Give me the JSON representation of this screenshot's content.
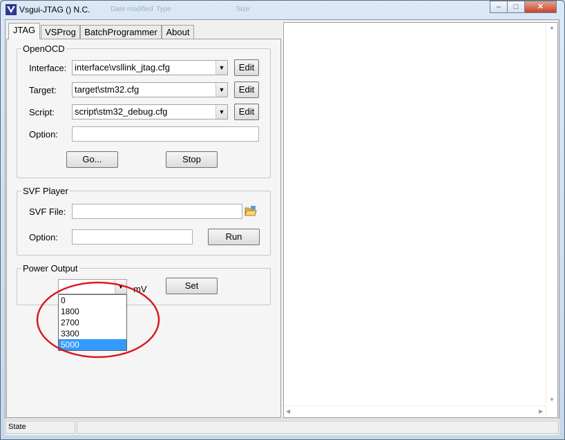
{
  "window": {
    "title": "Vsgui-JTAG () N.C.",
    "ghost_titles": [
      "Date modified",
      "Type",
      "Size"
    ],
    "caption_buttons": {
      "minimize": "–",
      "maximize": "□",
      "close": "✕"
    }
  },
  "tabs": [
    {
      "label": "JTAG",
      "active": true
    },
    {
      "label": "VSProg",
      "active": false
    },
    {
      "label": "BatchProgrammer",
      "active": false
    },
    {
      "label": "About",
      "active": false
    }
  ],
  "openocd": {
    "title": "OpenOCD",
    "interface_label": "Interface:",
    "interface_value": "interface\\vsllink_jtag.cfg",
    "target_label": "Target:",
    "target_value": "target\\stm32.cfg",
    "script_label": "Script:",
    "script_value": "script\\stm32_debug.cfg",
    "option_label": "Option:",
    "option_value": "",
    "edit_label": "Edit",
    "go_label": "Go...",
    "stop_label": "Stop"
  },
  "svf": {
    "title": "SVF Player",
    "file_label": "SVF File:",
    "file_value": "",
    "option_label": "Option:",
    "option_value": "",
    "run_label": "Run"
  },
  "power": {
    "title": "Power Output",
    "value": "",
    "unit": "mV",
    "set_label": "Set",
    "options": [
      "0",
      "1800",
      "2700",
      "3300",
      "5000"
    ],
    "selected": "5000"
  },
  "status": {
    "state_label": "State",
    "message": ""
  },
  "colors": {
    "selection": "#3399ff",
    "annotation_circle": "#d9181f",
    "title_bar": "#c9daea"
  },
  "icons": {
    "app": "vsgui-logo-icon",
    "browse": "folder-open-icon",
    "dropdown": "chevron-down-icon"
  }
}
